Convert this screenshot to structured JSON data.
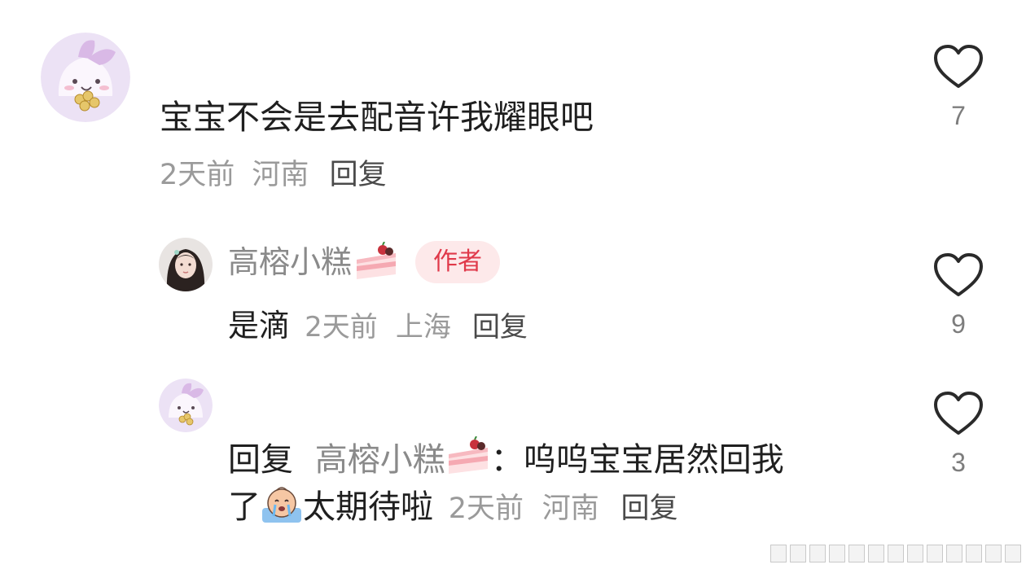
{
  "colors": {
    "author_badge_bg": "#fde9ea",
    "author_badge_text": "#e0394a",
    "meta_text": "#9a9a9a",
    "main_text": "#1f1f1f"
  },
  "comments": [
    {
      "avatar_icon": "bunny-avatar-icon",
      "text": "宝宝不会是去配音许我耀眼吧",
      "time": "2天前",
      "location": "河南",
      "reply_label": "回复",
      "likes": "7"
    }
  ],
  "replies": [
    {
      "avatar_icon": "girl-photo-avatar",
      "username": "高榕小糕",
      "username_emoji": "cake-icon",
      "badge": "作者",
      "text": "是滴",
      "time": "2天前",
      "location": "上海",
      "reply_label": "回复",
      "likes": "9"
    },
    {
      "avatar_icon": "bunny-avatar-icon",
      "reply_prefix": "回复",
      "reply_to": "高榕小糕",
      "reply_to_emoji": "cake-icon",
      "separator": "：",
      "text_part1": "呜呜宝宝居然回我",
      "text_part2": "了",
      "emoji": "crying-emoji-icon",
      "text_part3": "太期待啦",
      "time": "2天前",
      "location": "河南",
      "reply_label": "回复",
      "likes": "3"
    }
  ]
}
